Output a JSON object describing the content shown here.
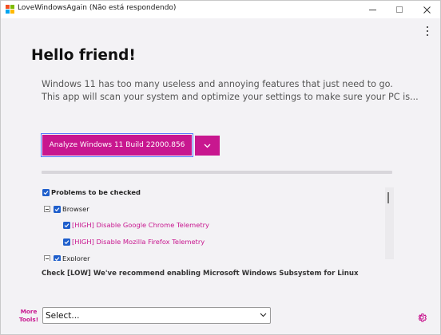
{
  "window": {
    "title": "LoveWindowsAgain (Não está respondendo)",
    "icon_colors": [
      "#f25022",
      "#7fba00",
      "#00a4ef",
      "#ffb900"
    ]
  },
  "header": {
    "greeting": "Hello friend!",
    "intro_line_1": "Windows 11 has too many useless and annoying features that just need to go.",
    "intro_line_2": "This app will scan your system and optimize your settings to make sure your PC is..."
  },
  "actions": {
    "analyze_label": "Analyze Windows 11 Build 22000.856",
    "dropdown_icon": "chevron-down-icon"
  },
  "tree": {
    "root": "Problems to be checked",
    "groups": [
      {
        "label": "Browser",
        "items": [
          "[HIGH] Disable Google Chrome Telemetry",
          "[HIGH] Disable Mozilla Firefox Telemetry"
        ]
      },
      {
        "label": "Explorer",
        "items": []
      }
    ]
  },
  "status": {
    "line": "Check [LOW] We've recommend enabling Microsoft Windows Subsystem for Linux"
  },
  "footer": {
    "more_tools_line1": "More",
    "more_tools_line2": "Tools!",
    "select_value": "Select...",
    "settings_icon": "gear-icon"
  },
  "colors": {
    "accent": "#c8178f",
    "checkbox": "#1f5fcc",
    "background": "#f3f2f5"
  }
}
